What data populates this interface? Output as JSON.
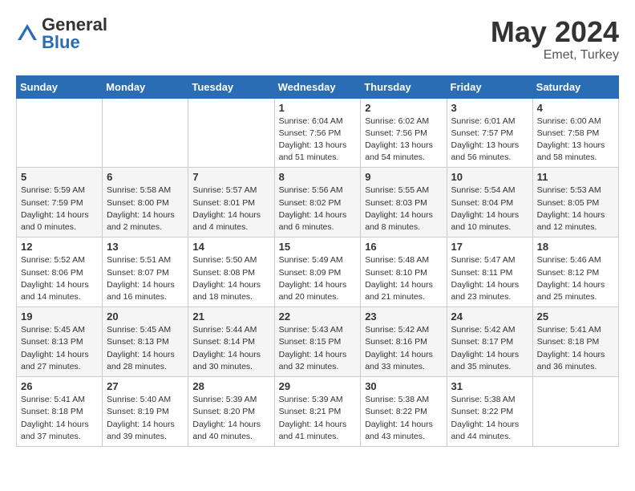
{
  "header": {
    "logo": {
      "general": "General",
      "blue": "Blue"
    },
    "title": "May 2024",
    "location": "Emet, Turkey"
  },
  "days_of_week": [
    "Sunday",
    "Monday",
    "Tuesday",
    "Wednesday",
    "Thursday",
    "Friday",
    "Saturday"
  ],
  "weeks": [
    [
      {
        "day": "",
        "info": ""
      },
      {
        "day": "",
        "info": ""
      },
      {
        "day": "",
        "info": ""
      },
      {
        "day": "1",
        "sunrise": "Sunrise: 6:04 AM",
        "sunset": "Sunset: 7:56 PM",
        "daylight": "Daylight: 13 hours and 51 minutes."
      },
      {
        "day": "2",
        "sunrise": "Sunrise: 6:02 AM",
        "sunset": "Sunset: 7:56 PM",
        "daylight": "Daylight: 13 hours and 54 minutes."
      },
      {
        "day": "3",
        "sunrise": "Sunrise: 6:01 AM",
        "sunset": "Sunset: 7:57 PM",
        "daylight": "Daylight: 13 hours and 56 minutes."
      },
      {
        "day": "4",
        "sunrise": "Sunrise: 6:00 AM",
        "sunset": "Sunset: 7:58 PM",
        "daylight": "Daylight: 13 hours and 58 minutes."
      }
    ],
    [
      {
        "day": "5",
        "sunrise": "Sunrise: 5:59 AM",
        "sunset": "Sunset: 7:59 PM",
        "daylight": "Daylight: 14 hours and 0 minutes."
      },
      {
        "day": "6",
        "sunrise": "Sunrise: 5:58 AM",
        "sunset": "Sunset: 8:00 PM",
        "daylight": "Daylight: 14 hours and 2 minutes."
      },
      {
        "day": "7",
        "sunrise": "Sunrise: 5:57 AM",
        "sunset": "Sunset: 8:01 PM",
        "daylight": "Daylight: 14 hours and 4 minutes."
      },
      {
        "day": "8",
        "sunrise": "Sunrise: 5:56 AM",
        "sunset": "Sunset: 8:02 PM",
        "daylight": "Daylight: 14 hours and 6 minutes."
      },
      {
        "day": "9",
        "sunrise": "Sunrise: 5:55 AM",
        "sunset": "Sunset: 8:03 PM",
        "daylight": "Daylight: 14 hours and 8 minutes."
      },
      {
        "day": "10",
        "sunrise": "Sunrise: 5:54 AM",
        "sunset": "Sunset: 8:04 PM",
        "daylight": "Daylight: 14 hours and 10 minutes."
      },
      {
        "day": "11",
        "sunrise": "Sunrise: 5:53 AM",
        "sunset": "Sunset: 8:05 PM",
        "daylight": "Daylight: 14 hours and 12 minutes."
      }
    ],
    [
      {
        "day": "12",
        "sunrise": "Sunrise: 5:52 AM",
        "sunset": "Sunset: 8:06 PM",
        "daylight": "Daylight: 14 hours and 14 minutes."
      },
      {
        "day": "13",
        "sunrise": "Sunrise: 5:51 AM",
        "sunset": "Sunset: 8:07 PM",
        "daylight": "Daylight: 14 hours and 16 minutes."
      },
      {
        "day": "14",
        "sunrise": "Sunrise: 5:50 AM",
        "sunset": "Sunset: 8:08 PM",
        "daylight": "Daylight: 14 hours and 18 minutes."
      },
      {
        "day": "15",
        "sunrise": "Sunrise: 5:49 AM",
        "sunset": "Sunset: 8:09 PM",
        "daylight": "Daylight: 14 hours and 20 minutes."
      },
      {
        "day": "16",
        "sunrise": "Sunrise: 5:48 AM",
        "sunset": "Sunset: 8:10 PM",
        "daylight": "Daylight: 14 hours and 21 minutes."
      },
      {
        "day": "17",
        "sunrise": "Sunrise: 5:47 AM",
        "sunset": "Sunset: 8:11 PM",
        "daylight": "Daylight: 14 hours and 23 minutes."
      },
      {
        "day": "18",
        "sunrise": "Sunrise: 5:46 AM",
        "sunset": "Sunset: 8:12 PM",
        "daylight": "Daylight: 14 hours and 25 minutes."
      }
    ],
    [
      {
        "day": "19",
        "sunrise": "Sunrise: 5:45 AM",
        "sunset": "Sunset: 8:13 PM",
        "daylight": "Daylight: 14 hours and 27 minutes."
      },
      {
        "day": "20",
        "sunrise": "Sunrise: 5:45 AM",
        "sunset": "Sunset: 8:13 PM",
        "daylight": "Daylight: 14 hours and 28 minutes."
      },
      {
        "day": "21",
        "sunrise": "Sunrise: 5:44 AM",
        "sunset": "Sunset: 8:14 PM",
        "daylight": "Daylight: 14 hours and 30 minutes."
      },
      {
        "day": "22",
        "sunrise": "Sunrise: 5:43 AM",
        "sunset": "Sunset: 8:15 PM",
        "daylight": "Daylight: 14 hours and 32 minutes."
      },
      {
        "day": "23",
        "sunrise": "Sunrise: 5:42 AM",
        "sunset": "Sunset: 8:16 PM",
        "daylight": "Daylight: 14 hours and 33 minutes."
      },
      {
        "day": "24",
        "sunrise": "Sunrise: 5:42 AM",
        "sunset": "Sunset: 8:17 PM",
        "daylight": "Daylight: 14 hours and 35 minutes."
      },
      {
        "day": "25",
        "sunrise": "Sunrise: 5:41 AM",
        "sunset": "Sunset: 8:18 PM",
        "daylight": "Daylight: 14 hours and 36 minutes."
      }
    ],
    [
      {
        "day": "26",
        "sunrise": "Sunrise: 5:41 AM",
        "sunset": "Sunset: 8:18 PM",
        "daylight": "Daylight: 14 hours and 37 minutes."
      },
      {
        "day": "27",
        "sunrise": "Sunrise: 5:40 AM",
        "sunset": "Sunset: 8:19 PM",
        "daylight": "Daylight: 14 hours and 39 minutes."
      },
      {
        "day": "28",
        "sunrise": "Sunrise: 5:39 AM",
        "sunset": "Sunset: 8:20 PM",
        "daylight": "Daylight: 14 hours and 40 minutes."
      },
      {
        "day": "29",
        "sunrise": "Sunrise: 5:39 AM",
        "sunset": "Sunset: 8:21 PM",
        "daylight": "Daylight: 14 hours and 41 minutes."
      },
      {
        "day": "30",
        "sunrise": "Sunrise: 5:38 AM",
        "sunset": "Sunset: 8:22 PM",
        "daylight": "Daylight: 14 hours and 43 minutes."
      },
      {
        "day": "31",
        "sunrise": "Sunrise: 5:38 AM",
        "sunset": "Sunset: 8:22 PM",
        "daylight": "Daylight: 14 hours and 44 minutes."
      },
      {
        "day": "",
        "info": ""
      }
    ]
  ]
}
